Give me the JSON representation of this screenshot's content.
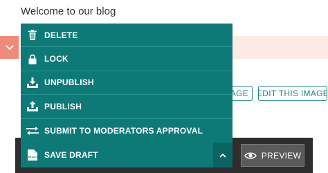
{
  "header": {
    "welcome_text": "Welcome to our blog"
  },
  "content": {
    "image_button_label": "AGE",
    "edit_image_button_label": "EDIT THIS IMAGE"
  },
  "publish_menu": {
    "items": [
      {
        "label": "DELETE",
        "icon": "trash-icon"
      },
      {
        "label": "LOCK",
        "icon": "lock-icon"
      },
      {
        "label": "UNPUBLISH",
        "icon": "download-tray-icon"
      },
      {
        "label": "PUBLISH",
        "icon": "upload-tray-icon"
      },
      {
        "label": "SUBMIT TO MODERATORS APPROVAL",
        "icon": "swap-arrows-icon"
      }
    ]
  },
  "toolbar": {
    "save_draft_label": "SAVE DRAFT",
    "save_draft_icon_text": "DRAFT",
    "preview_label": "PREVIEW"
  },
  "colors": {
    "menu_bg": "#0e7a77",
    "accent_outline": "#1d8583",
    "alert_band": "#fdeae6",
    "alert_toggle": "#f08b7c",
    "bottom_bar": "#2e2e2e"
  }
}
